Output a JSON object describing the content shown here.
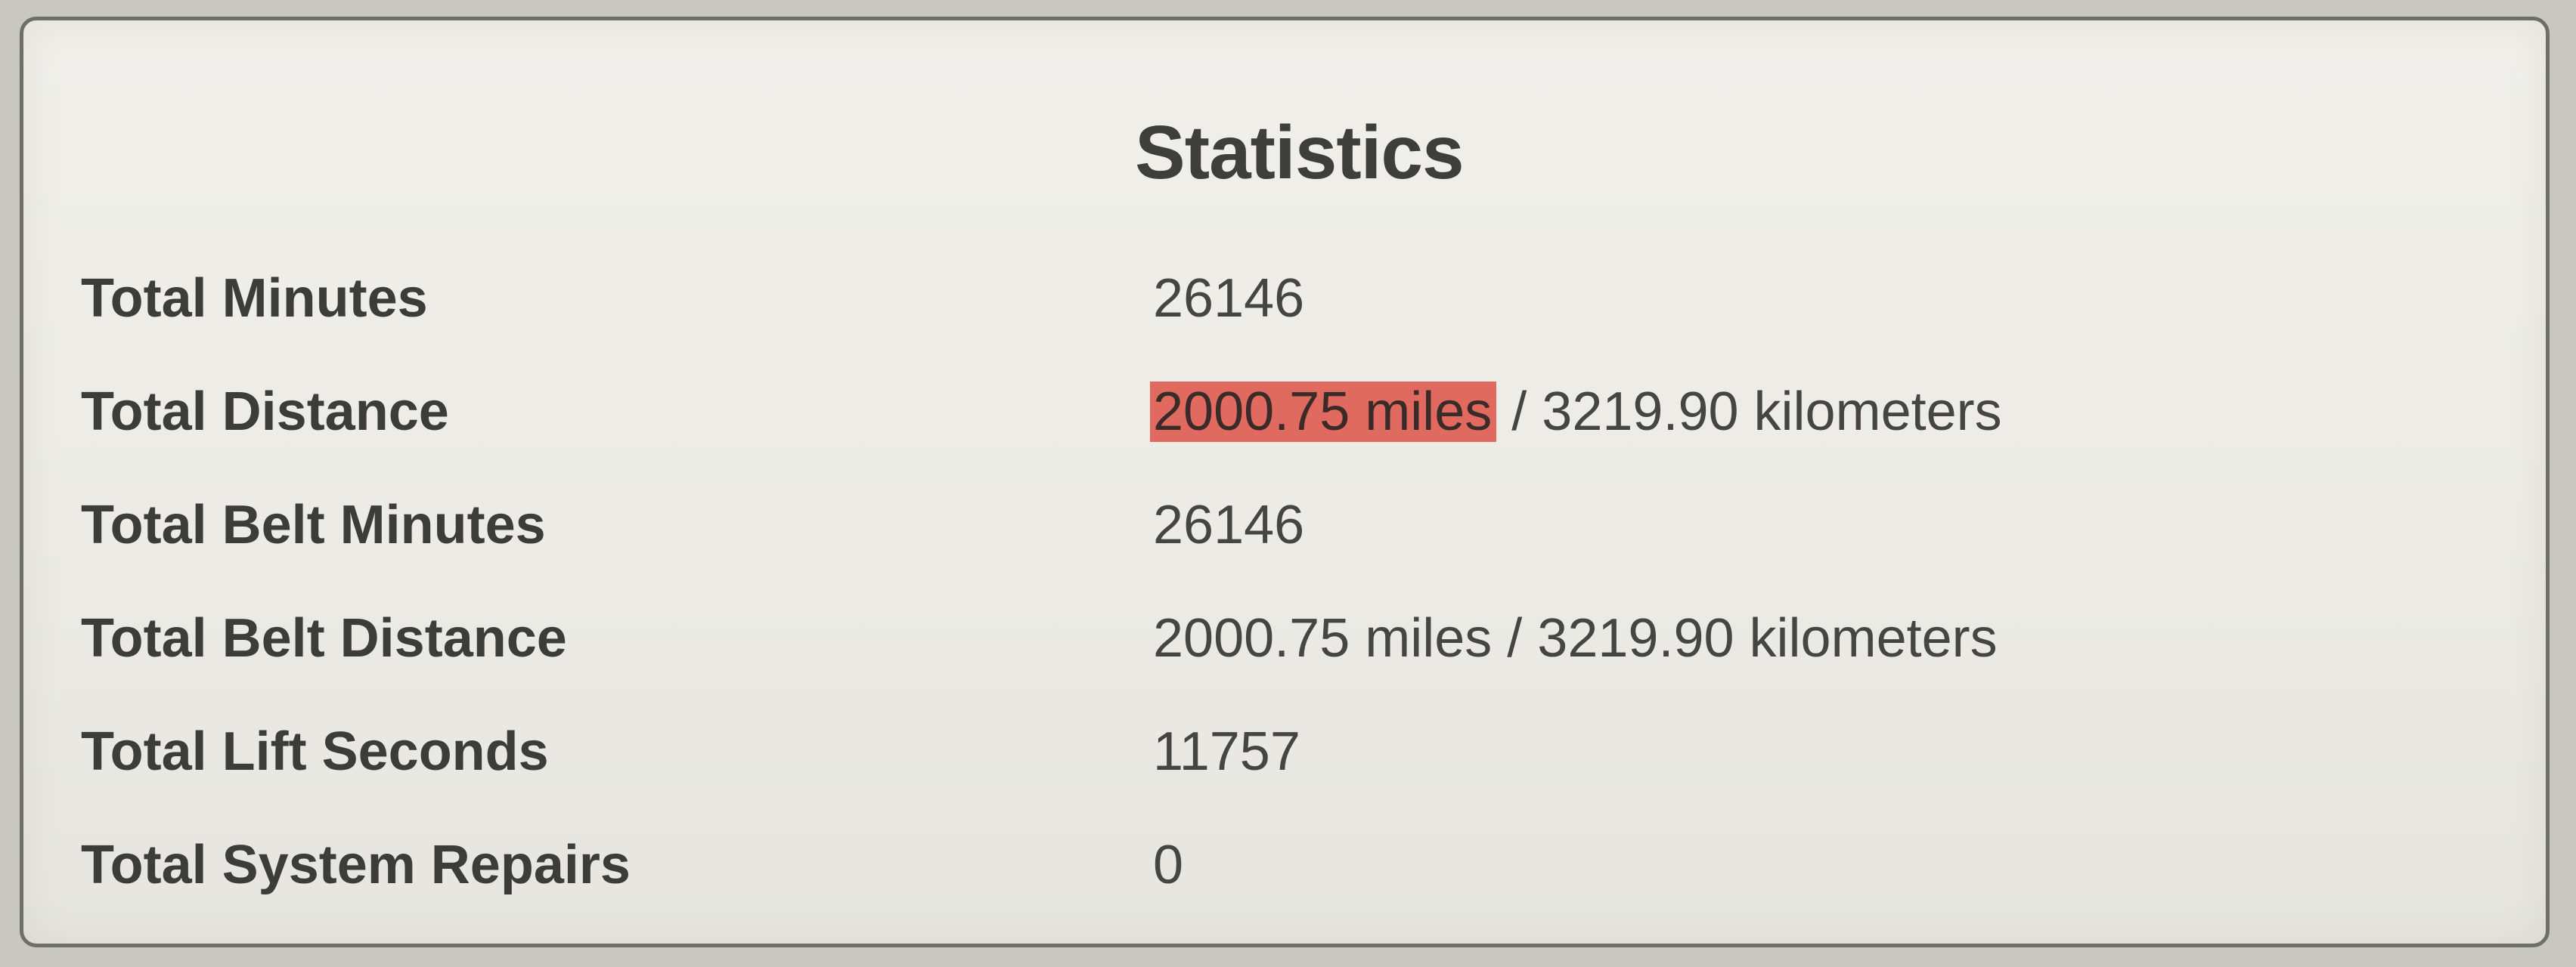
{
  "panel": {
    "title": "Statistics"
  },
  "stats": [
    {
      "label": "Total Minutes",
      "value": "26146"
    },
    {
      "label": "Total Distance",
      "value_highlight": "2000.75 miles",
      "value_rest": " / 3219.90 kilometers"
    },
    {
      "label": "Total Belt Minutes",
      "value": "26146"
    },
    {
      "label": "Total Belt Distance",
      "value": "2000.75 miles / 3219.90 kilometers"
    },
    {
      "label": "Total Lift Seconds",
      "value": "11757"
    },
    {
      "label": "Total System Repairs",
      "value": "0"
    }
  ],
  "colors": {
    "highlight": "#e06a60",
    "border": "#6f6f6a",
    "background": "#eeede7"
  }
}
